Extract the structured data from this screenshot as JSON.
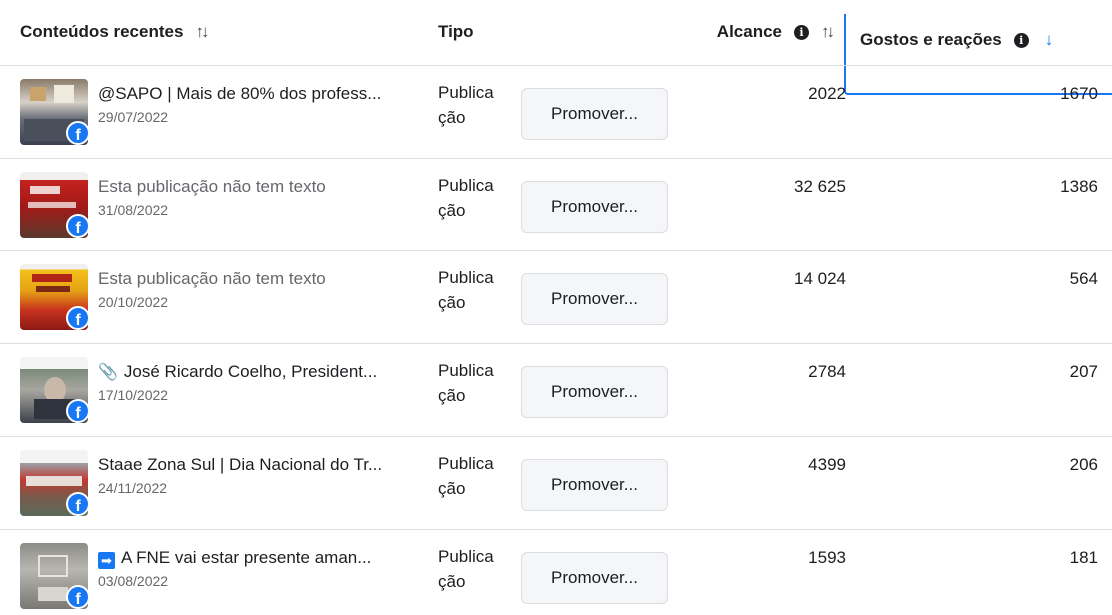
{
  "header": {
    "content_label": "Conteúdos recentes",
    "content_sort": "↑↓",
    "tipo_label": "Tipo",
    "alcance_label": "Alcance",
    "alcance_info": "i",
    "alcance_sort": "↑↓",
    "gostos_label": "Gostos e reações",
    "gostos_info": "i",
    "gostos_sort": "↓"
  },
  "rows": [
    {
      "title": "@SAPO | Mais de 80% dos profess...",
      "date": "29/07/2022",
      "tipo_line1": "Publica",
      "tipo_line2": "ção",
      "promote": "Promover...",
      "alcance": "2022",
      "gostos": "1670"
    },
    {
      "title": "Esta publicação não tem texto",
      "date": "31/08/2022",
      "tipo_line1": "Publica",
      "tipo_line2": "ção",
      "promote": "Promover...",
      "alcance": "32 625",
      "gostos": "1386"
    },
    {
      "title": "Esta publicação não tem texto",
      "date": "20/10/2022",
      "tipo_line1": "Publica",
      "tipo_line2": "ção",
      "promote": "Promover...",
      "alcance": "14 024",
      "gostos": "564"
    },
    {
      "title": "José Ricardo Coelho, President...",
      "date": "17/10/2022",
      "tipo_line1": "Publica",
      "tipo_line2": "ção",
      "promote": "Promover...",
      "alcance": "2784",
      "gostos": "207"
    },
    {
      "title": "Staae Zona Sul | Dia Nacional do Tr...",
      "date": "24/11/2022",
      "tipo_line1": "Publica",
      "tipo_line2": "ção",
      "promote": "Promover...",
      "alcance": "4399",
      "gostos": "206"
    },
    {
      "title": "A FNE vai estar presente aman...",
      "date": "03/08/2022",
      "tipo_line1": "Publica",
      "tipo_line2": "ção",
      "promote": "Promover...",
      "alcance": "1593",
      "gostos": "181"
    }
  ],
  "icons": {
    "platform": "facebook-icon",
    "info": "info-icon",
    "sort": "sort-icon",
    "row4_prefix": "paperclip-icon",
    "row6_prefix": "arrow-right-box-icon"
  },
  "colors": {
    "accent": "#1877f2",
    "divider": "#dadde1",
    "muted": "#65676b"
  }
}
